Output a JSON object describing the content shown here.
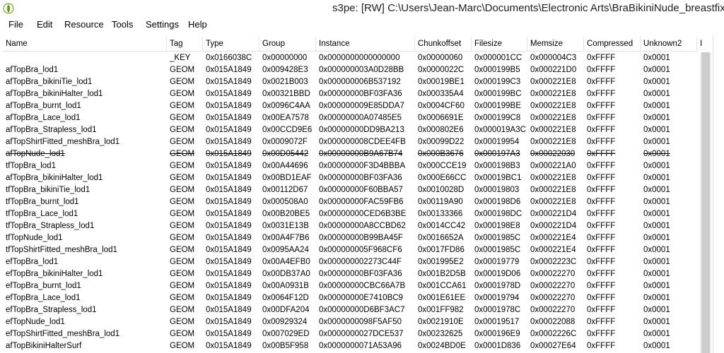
{
  "window": {
    "title": "s3pe: [RW] C:\\Users\\Jean-Marc\\Documents\\Electronic Arts\\BraBikiniNude_breastfix -"
  },
  "menu": [
    "File",
    "Edit",
    "Resource",
    "Tools",
    "Settings",
    "Help"
  ],
  "columns": [
    "Name",
    "Tag",
    "Type",
    "Group",
    "Instance",
    "Chunkoffset",
    "Filesize",
    "Memsize",
    "Compressed",
    "Unknown2",
    "I"
  ],
  "rows": [
    {
      "name": "",
      "tag": "_KEY",
      "type": "0x0166038C",
      "group": "0x00000000",
      "instance": "0x0000000000000000",
      "chunkoffset": "0x00000060",
      "filesize": "0x000001CC",
      "memsize": "0x000004C3",
      "compressed": "0xFFFF",
      "unknown2": "0x0001"
    },
    {
      "name": "afTopBra_lod1",
      "tag": "GEOM",
      "type": "0x015A1849",
      "group": "0x009428E3",
      "instance": "0x000000003A0D28BB",
      "chunkoffset": "0x0000022C",
      "filesize": "0x000199B5",
      "memsize": "0x000221D0",
      "compressed": "0xFFFF",
      "unknown2": "0x0001"
    },
    {
      "name": "afTopBra_bikiniTie_lod1",
      "tag": "GEOM",
      "type": "0x015A1849",
      "group": "0x0021B003",
      "instance": "0x000000006B537192",
      "chunkoffset": "0x00019BE1",
      "filesize": "0x000199C3",
      "memsize": "0x000221E8",
      "compressed": "0xFFFF",
      "unknown2": "0x0001"
    },
    {
      "name": "afTopBra_bikiniHalter_lod1",
      "tag": "GEOM",
      "type": "0x015A1849",
      "group": "0x00321BBD",
      "instance": "0x00000000BF03FA36",
      "chunkoffset": "0x000335A4",
      "filesize": "0x000199BC",
      "memsize": "0x000221E8",
      "compressed": "0xFFFF",
      "unknown2": "0x0001"
    },
    {
      "name": "afTopBra_burnt_lod1",
      "tag": "GEOM",
      "type": "0x015A1849",
      "group": "0x0096C4AA",
      "instance": "0x000000009E85DDA7",
      "chunkoffset": "0x0004CF60",
      "filesize": "0x000199BE",
      "memsize": "0x000221E8",
      "compressed": "0xFFFF",
      "unknown2": "0x0001"
    },
    {
      "name": "afTopBra_Lace_lod1",
      "tag": "GEOM",
      "type": "0x015A1849",
      "group": "0x00EA7578",
      "instance": "0x00000000A07485E5",
      "chunkoffset": "0x0006691E",
      "filesize": "0x000199C8",
      "memsize": "0x000221E8",
      "compressed": "0xFFFF",
      "unknown2": "0x0001"
    },
    {
      "name": "afTopBra_Strapless_lod1",
      "tag": "GEOM",
      "type": "0x015A1849",
      "group": "0x00CCD9E6",
      "instance": "0x00000000DD9BA213",
      "chunkoffset": "0x000802E6",
      "filesize": "0x000019A3C",
      "memsize": "0x000221E8",
      "compressed": "0xFFFF",
      "unknown2": "0x0001"
    },
    {
      "name": "afTopShirtFitted_meshBra_lod1",
      "tag": "GEOM",
      "type": "0x015A1849",
      "group": "0x0009072F",
      "instance": "0x000000008CDEE4FB",
      "chunkoffset": "0x00099D22",
      "filesize": "0x00019954",
      "memsize": "0x000221E8",
      "compressed": "0xFFFF",
      "unknown2": "0x0001"
    },
    {
      "name": "afTopNude_lod1",
      "tag": "GEOM",
      "type": "0x015A1849",
      "group": "0x00D05442",
      "instance": "0x00000000B9A67B74",
      "chunkoffset": "0x000B3676",
      "filesize": "0x000197A3",
      "memsize": "0x00022030",
      "compressed": "0xFFFF",
      "unknown2": "0x0001",
      "deleted": true
    },
    {
      "name": "tfTopBra_lod1",
      "tag": "GEOM",
      "type": "0x015A1849",
      "group": "0x00A44696",
      "instance": "0x00000000F3D4BBBA",
      "chunkoffset": "0x000CCE19",
      "filesize": "0x000198B3",
      "memsize": "0x000221A0",
      "compressed": "0xFFFF",
      "unknown2": "0x0001"
    },
    {
      "name": "afTopBra_bikiniHalter_lod1",
      "tag": "GEOM",
      "type": "0x015A1849",
      "group": "0x00BD1EAF",
      "instance": "0x00000000BF03FA36",
      "chunkoffset": "0x000E66CC",
      "filesize": "0x00019BC1",
      "memsize": "0x000221E8",
      "compressed": "0xFFFF",
      "unknown2": "0x0001"
    },
    {
      "name": "tfTopBra_bikiniTie_lod1",
      "tag": "GEOM",
      "type": "0x015A1849",
      "group": "0x00112D67",
      "instance": "0x00000000F60BBA57",
      "chunkoffset": "0x0010028D",
      "filesize": "0x00019803",
      "memsize": "0x000221E8",
      "compressed": "0xFFFF",
      "unknown2": "0x0001"
    },
    {
      "name": "tfTopBra_burnt_lod1",
      "tag": "GEOM",
      "type": "0x015A1849",
      "group": "0x000508A0",
      "instance": "0x00000000FAC59FB6",
      "chunkoffset": "0x00119A90",
      "filesize": "0x000198D6",
      "memsize": "0x000221E8",
      "compressed": "0xFFFF",
      "unknown2": "0x0001"
    },
    {
      "name": "tfTopBra_Lace_lod1",
      "tag": "GEOM",
      "type": "0x015A1849",
      "group": "0x00B20BE5",
      "instance": "0x00000000CED6B3BE",
      "chunkoffset": "0x00133366",
      "filesize": "0x000198DC",
      "memsize": "0x000221D4",
      "compressed": "0xFFFF",
      "unknown2": "0x0001"
    },
    {
      "name": "tfTopBra_Strapless_lod1",
      "tag": "GEOM",
      "type": "0x015A1849",
      "group": "0x0031E13B",
      "instance": "0x00000000A8CCBD62",
      "chunkoffset": "0x0014CC42",
      "filesize": "0x000198E8",
      "memsize": "0x000221D4",
      "compressed": "0xFFFF",
      "unknown2": "0x0001"
    },
    {
      "name": "tfTopNude_lod1",
      "tag": "GEOM",
      "type": "0x015A1849",
      "group": "0x00A4F7B6",
      "instance": "0x00000000B99BA45F",
      "chunkoffset": "0x0016652A",
      "filesize": "0x0001985C",
      "memsize": "0x000221E4",
      "compressed": "0xFFFF",
      "unknown2": "0x0001"
    },
    {
      "name": "tfTopShirtFitted_meshBra_lod1",
      "tag": "GEOM",
      "type": "0x015A1849",
      "group": "0x0095AA24",
      "instance": "0x000000005F968CF6",
      "chunkoffset": "0x0017FD86",
      "filesize": "0x0001985C",
      "memsize": "0x000221E4",
      "compressed": "0xFFFF",
      "unknown2": "0x0001"
    },
    {
      "name": "efTopBra_lod1",
      "tag": "GEOM",
      "type": "0x015A1849",
      "group": "0x00A4EFB0",
      "instance": "0x000000002273C44F",
      "chunkoffset": "0x001995E2",
      "filesize": "0x00019779",
      "memsize": "0x0002223C",
      "compressed": "0xFFFF",
      "unknown2": "0x0001"
    },
    {
      "name": "efTopBra_bikiniHalter_lod1",
      "tag": "GEOM",
      "type": "0x015A1849",
      "group": "0x00DB37A0",
      "instance": "0x00000000BF03FA36",
      "chunkoffset": "0x001B2D5B",
      "filesize": "0x00019D06",
      "memsize": "0x00022270",
      "compressed": "0xFFFF",
      "unknown2": "0x0001"
    },
    {
      "name": "efTopBra_burnt_lod1",
      "tag": "GEOM",
      "type": "0x015A1849",
      "group": "0x00A0931B",
      "instance": "0x00000000CBC66A7B",
      "chunkoffset": "0x001CCA61",
      "filesize": "0x0001978D",
      "memsize": "0x00022270",
      "compressed": "0xFFFF",
      "unknown2": "0x0001"
    },
    {
      "name": "efTopBra_Lace_lod1",
      "tag": "GEOM",
      "type": "0x015A1849",
      "group": "0x0064F12D",
      "instance": "0x00000000E7410BC9",
      "chunkoffset": "0x001E61EE",
      "filesize": "0x00019794",
      "memsize": "0x00022270",
      "compressed": "0xFFFF",
      "unknown2": "0x0001"
    },
    {
      "name": "efTopBra_Strapless_lod1",
      "tag": "GEOM",
      "type": "0x015A1849",
      "group": "0x00DFA204",
      "instance": "0x00000000D6BF3AC7",
      "chunkoffset": "0x001FF982",
      "filesize": "0x0001978C",
      "memsize": "0x00022270",
      "compressed": "0xFFFF",
      "unknown2": "0x0001"
    },
    {
      "name": "efTopNude_lod1",
      "tag": "GEOM",
      "type": "0x015A1849",
      "group": "0x00929324",
      "instance": "0x0000000098F5AF50",
      "chunkoffset": "0x0021910E",
      "filesize": "0x00019517",
      "memsize": "0x00022088",
      "compressed": "0xFFFF",
      "unknown2": "0x0001"
    },
    {
      "name": "efTopShirtFitted_meshBra_lod1",
      "tag": "GEOM",
      "type": "0x015A1849",
      "group": "0x007029ED",
      "instance": "0x0000000027DCE537",
      "chunkoffset": "0x00232625",
      "filesize": "0x000196E9",
      "memsize": "0x0002226C",
      "compressed": "0xFFFF",
      "unknown2": "0x0001"
    },
    {
      "name": "afTopBikiniHalterSurf",
      "tag": "GEOM",
      "type": "0x015A1849",
      "group": "0x00B5F958",
      "instance": "0x0000000071A53A96",
      "chunkoffset": "0x0024BD0E",
      "filesize": "0x0001D836",
      "memsize": "0x00027E64",
      "compressed": "0xFFFF",
      "unknown2": "0x0001"
    }
  ]
}
